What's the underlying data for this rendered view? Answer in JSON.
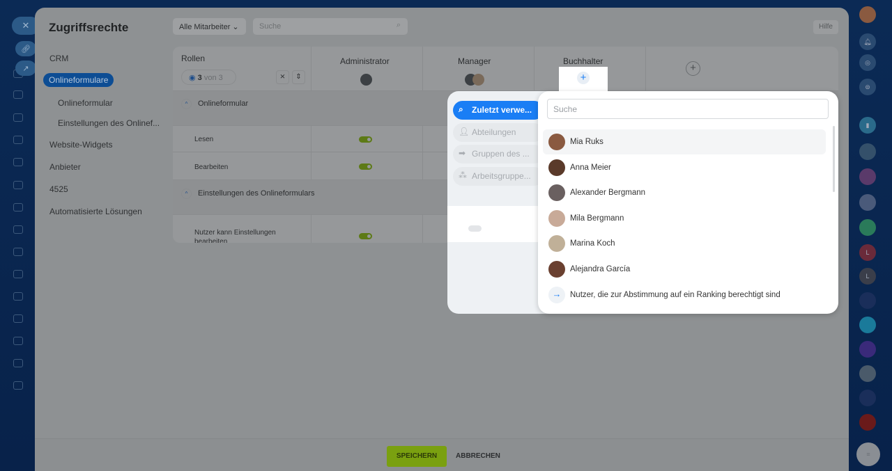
{
  "page": {
    "title": "Zugriffsrechte",
    "filter": "Alle Mitarbeiter",
    "search_placeholder": "Suche",
    "help": "Hilfe"
  },
  "sidebar": {
    "items": [
      {
        "label": "CRM"
      },
      {
        "label": "Onlineformulare",
        "active": true
      },
      {
        "label": "Onlineformular",
        "sub": true
      },
      {
        "label": "Einstellungen des Onlinef...",
        "sub": true
      },
      {
        "label": "Website-Widgets"
      },
      {
        "label": "Anbieter"
      },
      {
        "label": "4525"
      },
      {
        "label": "Automatisierte Lösungen"
      }
    ]
  },
  "table": {
    "roles_label": "Rollen",
    "visible_count": "3",
    "visible_of": "von 3",
    "columns": [
      "Administrator",
      "Manager",
      "Buchhalter"
    ],
    "groups": [
      {
        "title": "Onlineformular",
        "rows": [
          {
            "label": "Lesen",
            "admin": true
          },
          {
            "label": "Bearbeiten",
            "admin": true
          }
        ]
      },
      {
        "title": "Einstellungen des Onlineformulars",
        "rows": [
          {
            "label": "Nutzer kann Einstellungen bearbeiten",
            "admin": true,
            "manager": false
          }
        ]
      }
    ]
  },
  "footer": {
    "save": "SPEICHERN",
    "cancel": "ABBRECHEN"
  },
  "popup": {
    "categories": [
      "Zuletzt verwe...",
      "Abteilungen",
      "Gruppen des ...",
      "Arbeitsgruppe..."
    ],
    "search_placeholder": "Suche",
    "users": [
      "Mia Ruks",
      "Anna Meier",
      "Alexander Bergmann",
      "Mila Bergmann",
      "Marina Koch",
      "Alejandra García"
    ],
    "link": "Nutzer, die zur Abstimmung auf ein Ranking berechtigt sind"
  },
  "right_sidebar": {
    "letters": [
      "L",
      "L"
    ]
  },
  "colors": {
    "accent": "#1a7ef5",
    "toggle_on": "#7aa010",
    "save": "#7aa010"
  }
}
